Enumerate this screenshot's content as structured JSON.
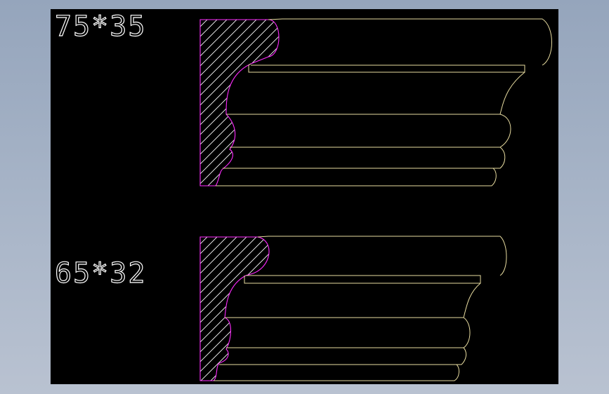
{
  "colors": {
    "background_outer": "#a7b4c7",
    "canvas": "#000000",
    "profile_outline": "#e8dca0",
    "section_outline": "#ff2bff",
    "hatch": "#ffffff",
    "label": "#ffffff"
  },
  "profiles": [
    {
      "label": "75*35"
    },
    {
      "label": "65*32"
    }
  ]
}
